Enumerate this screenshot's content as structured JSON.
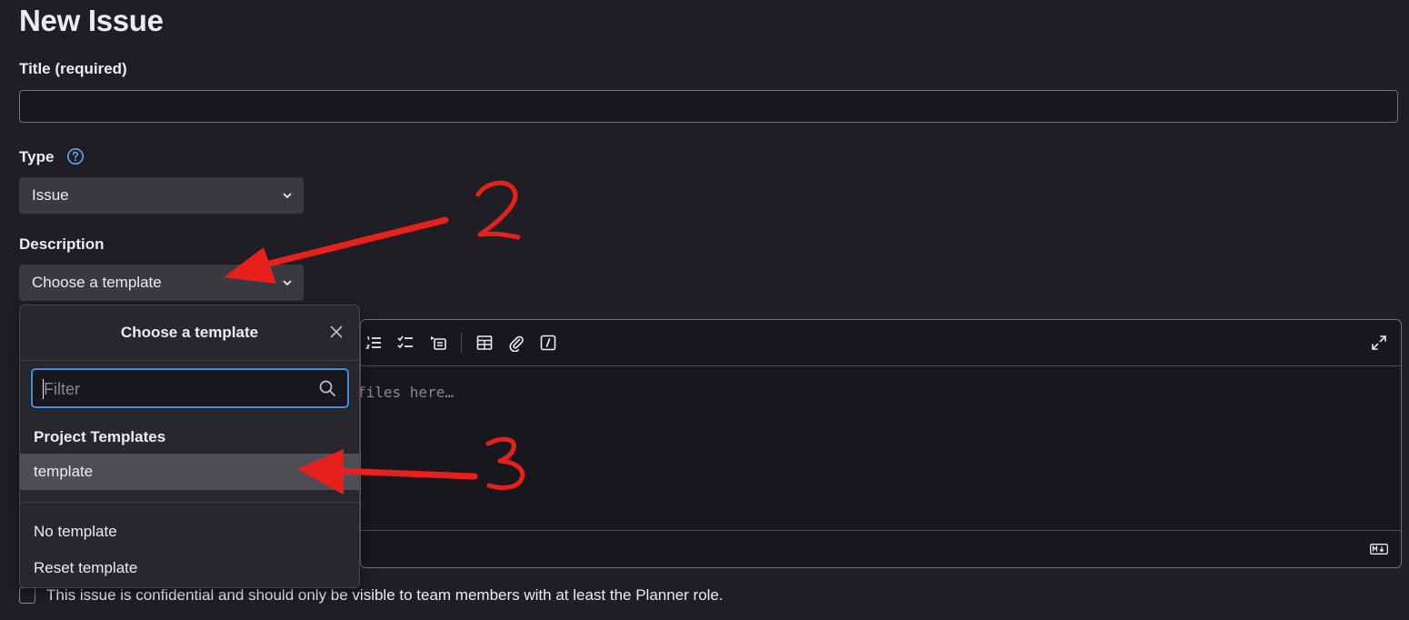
{
  "page_title": "New Issue",
  "title_field": {
    "label": "Title (required)",
    "value": ""
  },
  "type_field": {
    "label": "Type",
    "selected": "Issue"
  },
  "description": {
    "label": "Description",
    "template_select": "Choose a template",
    "editor_placeholder": "files here…"
  },
  "template_dropdown": {
    "title": "Choose a template",
    "filter_placeholder": "Filter",
    "group_label": "Project Templates",
    "items": [
      "template"
    ],
    "actions": [
      "No template",
      "Reset template"
    ]
  },
  "confidential_text": "This issue is confidential and should only be visible to team members with at least the Planner role.",
  "annotations": {
    "label_2": "2",
    "label_3": "3",
    "color": "#e8201c"
  },
  "colors": {
    "background": "#1f1e24",
    "focus_ring": "#428fdc",
    "annotation": "#e8201c"
  }
}
